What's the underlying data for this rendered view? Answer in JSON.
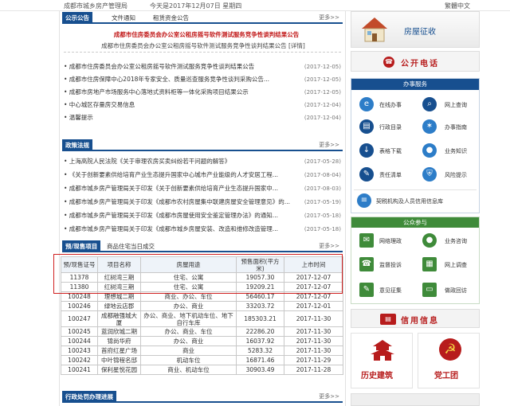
{
  "topbar": {
    "site": "成都市城乡房产管理局",
    "today": "今天是2017年12月07日  星期四",
    "lang": "繁體中文"
  },
  "announce": {
    "tabs": [
      "公示公告",
      "文件通知",
      "租赁资金公告"
    ],
    "more": "更多>>",
    "headline1": "成都市住房委员会办公室公租房摇号软件测试服务竞争性谈判结果公告",
    "headline2": "成都市住房委员会办公室公租房摇号软件测试服务竞争性谈判结果公告 [详情]",
    "items": [
      {
        "title": "成都市住房委员会办公室公租房摇号软件测试服务竞争性谈判结果公告",
        "date": "(2017-12-05)"
      },
      {
        "title": "成都市住房保障中心2018年专家安全、质量巡查服务竞争性谈判采购公告...",
        "date": "(2017-12-05)"
      },
      {
        "title": "成都市房地产市场服务中心落地式资料柜等一体化采购项目结果公示",
        "date": "(2017-12-05)"
      },
      {
        "title": "中心城区存量房交易信息",
        "date": "(2017-12-04)"
      },
      {
        "title": "温馨提示",
        "date": "(2017-12-04)"
      }
    ]
  },
  "policy": {
    "tab": "政策法规",
    "more": "更多>>",
    "items": [
      {
        "title": "上海高院人民法院《关于审理农房买卖纠纷若干问题的解答》",
        "date": "(2017-05-28)"
      },
      {
        "title": "《关于创新要素供给培育产业生态提升国家中心城市产业能级的人才安居工程...",
        "date": "(2017-08-04)"
      },
      {
        "title": "成都市城乡房产管理局关于印发《关于创新要素供给培育产业生态提升国家中...",
        "date": "(2017-08-03)"
      },
      {
        "title": "成都市城乡房产管理局关于印发《成都市农村房屋集中联建房屋安全管理意见》的...",
        "date": "(2017-05-19)"
      },
      {
        "title": "成都市城乡房产管理局关于印发《成都市房屋使用安全鉴定管理办法》的通知...",
        "date": "(2017-05-18)"
      },
      {
        "title": "成都市城乡房产管理局关于印发《成都市城乡房屋安装、改造和维修改造管理...",
        "date": "(2017-05-18)"
      }
    ]
  },
  "presale": {
    "tabs": [
      "预/现售项目",
      "商品住宅当日成交"
    ],
    "more": "更多>>",
    "headers": [
      "预/现售证号",
      "项目名称",
      "房屋用途",
      "预售面积(平方米)",
      "上市时间"
    ],
    "rows": [
      [
        "11378",
        "红树湾三期",
        "住宅、公寓",
        "19057.30",
        "2017-12-07"
      ],
      [
        "11380",
        "红树湾三期",
        "住宅、公寓",
        "19209.21",
        "2017-12-07"
      ],
      [
        "100248",
        "理想城二期",
        "商业、办公、车位",
        "56460.17",
        "2017-12-07"
      ],
      [
        "100246",
        "绿地云店郡",
        "办公、商业",
        "33203.72",
        "2017-12-01"
      ],
      [
        "100247",
        "成都融强城大厦",
        "办公、商业、地下机动车位、地下自行车库",
        "185303.21",
        "2017-11-30"
      ],
      [
        "100245",
        "蓝润欣城二期",
        "办公、商业、车位",
        "22286.20",
        "2017-11-30"
      ],
      [
        "100244",
        "锦尚华府",
        "办公、商业",
        "16037.92",
        "2017-11-30"
      ],
      [
        "100243",
        "首府红星广场",
        "商业",
        "5283.32",
        "2017-11-30"
      ],
      [
        "100242",
        "中叶锦程名邸",
        "机动车位",
        "16871.46",
        "2017-11-29"
      ],
      [
        "100241",
        "保利星悦花园",
        "商业、机动车位",
        "30903.49",
        "2017-11-28"
      ]
    ]
  },
  "admin": {
    "tab": "行政处罚办理进展",
    "more": "更多>>"
  },
  "right": {
    "fangwu": "房屋征收",
    "gongkai": "公开电话",
    "banshi_title": "办事服务",
    "banshi": [
      "在线办事",
      "网上查询",
      "行政目录",
      "办事指南",
      "表格下载",
      "业务知识",
      "责任清单",
      "风险提示"
    ],
    "xinyong_link": "契税机构及人员信用信息库",
    "gongzhong_title": "公众参与",
    "gongzhong": [
      "网络理政",
      "业务咨询",
      "监督投诉",
      "网上调查",
      "意见征集",
      "做政回访"
    ],
    "xinyong": "信用信息",
    "lishi": "历史建筑",
    "dangwu": "党工团",
    "accent_blue": "#174f8f",
    "accent_green": "#3f8b3a",
    "accent_red": "#b71c1c"
  }
}
